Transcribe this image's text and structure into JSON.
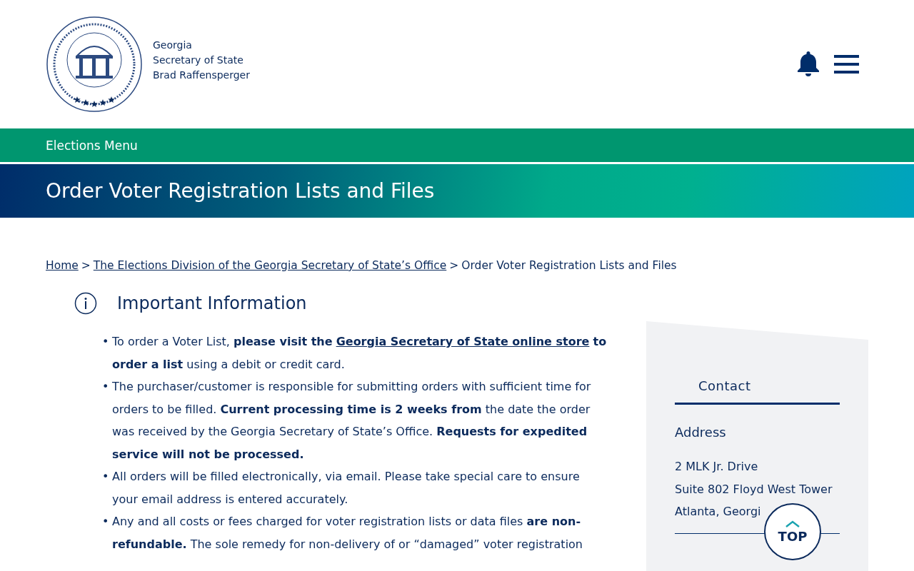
{
  "header": {
    "logo_lines": [
      "Georgia",
      "Secretary of State",
      "Brad Raffensperger"
    ]
  },
  "nav": {
    "label": "Elections Menu"
  },
  "banner": {
    "title": "Order Voter Registration Lists and Files"
  },
  "breadcrumb": {
    "separator": ">",
    "items": [
      {
        "label": "Home",
        "link": true
      },
      {
        "label": "The Elections Division of the Georgia Secretary of State’s Office",
        "link": true
      },
      {
        "label": "Order Voter Registration Lists and Files",
        "link": false
      }
    ]
  },
  "info": {
    "heading": "Important Information",
    "bullet": "•",
    "items": [
      {
        "parts": [
          {
            "kind": "text",
            "text": "To order a Voter List, **please visit the** "
          },
          {
            "kind": "link",
            "text": "Georgia Secretary of State online store"
          },
          {
            "kind": "text",
            "text": " **to order a list** using a debit or credit card."
          }
        ]
      },
      {
        "parts": [
          {
            "kind": "text",
            "text": "The purchaser/customer is responsible for submitting orders with sufficient time for orders to be filled. **Current processing time is 2 weeks from** the date the order was received by the Georgia Secretary of State’s Office. **Requests for expedited service will not be processed.**"
          }
        ]
      },
      {
        "parts": [
          {
            "kind": "text",
            "text": "All orders will be filled electronically, via email. Please take special care to ensure your email address is entered accurately."
          }
        ]
      },
      {
        "parts": [
          {
            "kind": "text",
            "text": "Any and all costs or fees charged for voter registration lists or data files **are non-refundable.** The sole remedy for non-delivery of or “damaged” voter registration"
          }
        ]
      }
    ]
  },
  "sidebar": {
    "heading": "Contact",
    "address_label": "Address",
    "address_lines": [
      "2 MLK Jr. Drive",
      "Suite 802 Floyd West Tower",
      "Atlanta, Georgi"
    ]
  },
  "top_button": {
    "label": "TOP"
  }
}
